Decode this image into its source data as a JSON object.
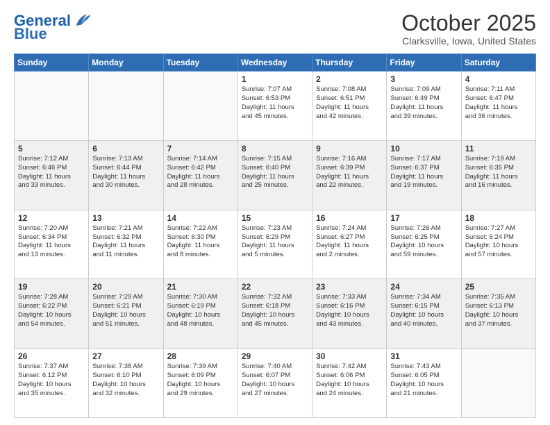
{
  "header": {
    "logo_general": "General",
    "logo_blue": "Blue",
    "month": "October 2025",
    "location": "Clarksville, Iowa, United States"
  },
  "days_of_week": [
    "Sunday",
    "Monday",
    "Tuesday",
    "Wednesday",
    "Thursday",
    "Friday",
    "Saturday"
  ],
  "weeks": [
    {
      "bg": "white",
      "days": [
        {
          "num": "",
          "info": ""
        },
        {
          "num": "",
          "info": ""
        },
        {
          "num": "",
          "info": ""
        },
        {
          "num": "1",
          "info": "Sunrise: 7:07 AM\nSunset: 6:53 PM\nDaylight: 11 hours\nand 45 minutes."
        },
        {
          "num": "2",
          "info": "Sunrise: 7:08 AM\nSunset: 6:51 PM\nDaylight: 11 hours\nand 42 minutes."
        },
        {
          "num": "3",
          "info": "Sunrise: 7:09 AM\nSunset: 6:49 PM\nDaylight: 11 hours\nand 39 minutes."
        },
        {
          "num": "4",
          "info": "Sunrise: 7:11 AM\nSunset: 6:47 PM\nDaylight: 11 hours\nand 36 minutes."
        }
      ]
    },
    {
      "bg": "gray",
      "days": [
        {
          "num": "5",
          "info": "Sunrise: 7:12 AM\nSunset: 6:46 PM\nDaylight: 11 hours\nand 33 minutes."
        },
        {
          "num": "6",
          "info": "Sunrise: 7:13 AM\nSunset: 6:44 PM\nDaylight: 11 hours\nand 30 minutes."
        },
        {
          "num": "7",
          "info": "Sunrise: 7:14 AM\nSunset: 6:42 PM\nDaylight: 11 hours\nand 28 minutes."
        },
        {
          "num": "8",
          "info": "Sunrise: 7:15 AM\nSunset: 6:40 PM\nDaylight: 11 hours\nand 25 minutes."
        },
        {
          "num": "9",
          "info": "Sunrise: 7:16 AM\nSunset: 6:39 PM\nDaylight: 11 hours\nand 22 minutes."
        },
        {
          "num": "10",
          "info": "Sunrise: 7:17 AM\nSunset: 6:37 PM\nDaylight: 11 hours\nand 19 minutes."
        },
        {
          "num": "11",
          "info": "Sunrise: 7:19 AM\nSunset: 6:35 PM\nDaylight: 11 hours\nand 16 minutes."
        }
      ]
    },
    {
      "bg": "white",
      "days": [
        {
          "num": "12",
          "info": "Sunrise: 7:20 AM\nSunset: 6:34 PM\nDaylight: 11 hours\nand 13 minutes."
        },
        {
          "num": "13",
          "info": "Sunrise: 7:21 AM\nSunset: 6:32 PM\nDaylight: 11 hours\nand 11 minutes."
        },
        {
          "num": "14",
          "info": "Sunrise: 7:22 AM\nSunset: 6:30 PM\nDaylight: 11 hours\nand 8 minutes."
        },
        {
          "num": "15",
          "info": "Sunrise: 7:23 AM\nSunset: 6:29 PM\nDaylight: 11 hours\nand 5 minutes."
        },
        {
          "num": "16",
          "info": "Sunrise: 7:24 AM\nSunset: 6:27 PM\nDaylight: 11 hours\nand 2 minutes."
        },
        {
          "num": "17",
          "info": "Sunrise: 7:26 AM\nSunset: 6:25 PM\nDaylight: 10 hours\nand 59 minutes."
        },
        {
          "num": "18",
          "info": "Sunrise: 7:27 AM\nSunset: 6:24 PM\nDaylight: 10 hours\nand 57 minutes."
        }
      ]
    },
    {
      "bg": "gray",
      "days": [
        {
          "num": "19",
          "info": "Sunrise: 7:28 AM\nSunset: 6:22 PM\nDaylight: 10 hours\nand 54 minutes."
        },
        {
          "num": "20",
          "info": "Sunrise: 7:29 AM\nSunset: 6:21 PM\nDaylight: 10 hours\nand 51 minutes."
        },
        {
          "num": "21",
          "info": "Sunrise: 7:30 AM\nSunset: 6:19 PM\nDaylight: 10 hours\nand 48 minutes."
        },
        {
          "num": "22",
          "info": "Sunrise: 7:32 AM\nSunset: 6:18 PM\nDaylight: 10 hours\nand 45 minutes."
        },
        {
          "num": "23",
          "info": "Sunrise: 7:33 AM\nSunset: 6:16 PM\nDaylight: 10 hours\nand 43 minutes."
        },
        {
          "num": "24",
          "info": "Sunrise: 7:34 AM\nSunset: 6:15 PM\nDaylight: 10 hours\nand 40 minutes."
        },
        {
          "num": "25",
          "info": "Sunrise: 7:35 AM\nSunset: 6:13 PM\nDaylight: 10 hours\nand 37 minutes."
        }
      ]
    },
    {
      "bg": "white",
      "days": [
        {
          "num": "26",
          "info": "Sunrise: 7:37 AM\nSunset: 6:12 PM\nDaylight: 10 hours\nand 35 minutes."
        },
        {
          "num": "27",
          "info": "Sunrise: 7:38 AM\nSunset: 6:10 PM\nDaylight: 10 hours\nand 32 minutes."
        },
        {
          "num": "28",
          "info": "Sunrise: 7:39 AM\nSunset: 6:09 PM\nDaylight: 10 hours\nand 29 minutes."
        },
        {
          "num": "29",
          "info": "Sunrise: 7:40 AM\nSunset: 6:07 PM\nDaylight: 10 hours\nand 27 minutes."
        },
        {
          "num": "30",
          "info": "Sunrise: 7:42 AM\nSunset: 6:06 PM\nDaylight: 10 hours\nand 24 minutes."
        },
        {
          "num": "31",
          "info": "Sunrise: 7:43 AM\nSunset: 6:05 PM\nDaylight: 10 hours\nand 21 minutes."
        },
        {
          "num": "",
          "info": ""
        }
      ]
    }
  ]
}
